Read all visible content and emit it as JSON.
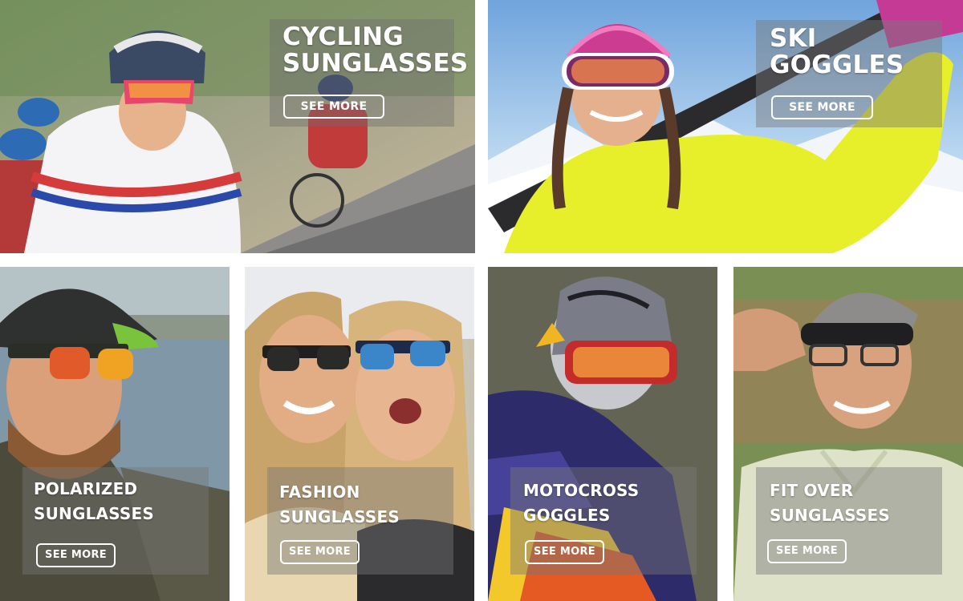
{
  "tiles": {
    "cycling": {
      "title_line1": "CYCLING",
      "title_line2": "SUNGLASSES",
      "button": "SEE MORE"
    },
    "ski": {
      "title_line1": "SKI",
      "title_line2": "GOGGLES",
      "button": "SEE MORE"
    },
    "polarized": {
      "title_line1": "POLARIZED",
      "title_line2": "SUNGLASSES",
      "button": "SEE MORE"
    },
    "fashion": {
      "title_line1": "FASHION",
      "title_line2": "SUNGLASSES",
      "button": "SEE MORE"
    },
    "motocross": {
      "title_line1": "MOTOCROSS",
      "title_line2": "GOGGLES",
      "button": "SEE MORE"
    },
    "fitover": {
      "title_line1": "FIT OVER",
      "title_line2": "SUNGLASSES",
      "button": "SEE MORE"
    }
  },
  "colors": {
    "text": "#ffffff",
    "overlay": "rgba(120,120,120,0.45)",
    "page_background": "#ffffff"
  }
}
